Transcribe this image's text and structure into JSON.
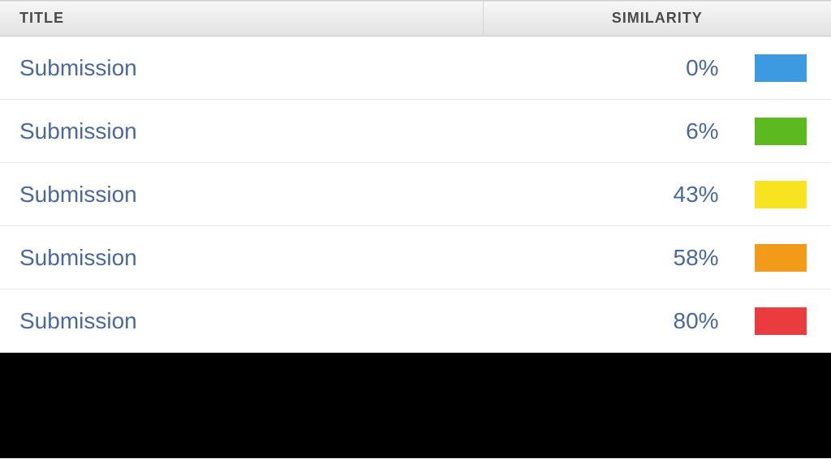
{
  "headers": {
    "title": "TITLE",
    "similarity": "SIMILARITY"
  },
  "rows": [
    {
      "title": "Submission",
      "similarity": "0%",
      "color": "#3e9ae0"
    },
    {
      "title": "Submission",
      "similarity": "6%",
      "color": "#5cb91f"
    },
    {
      "title": "Submission",
      "similarity": "43%",
      "color": "#f7e320"
    },
    {
      "title": "Submission",
      "similarity": "58%",
      "color": "#f29b18"
    },
    {
      "title": "Submission",
      "similarity": "80%",
      "color": "#ea3b3e"
    }
  ]
}
